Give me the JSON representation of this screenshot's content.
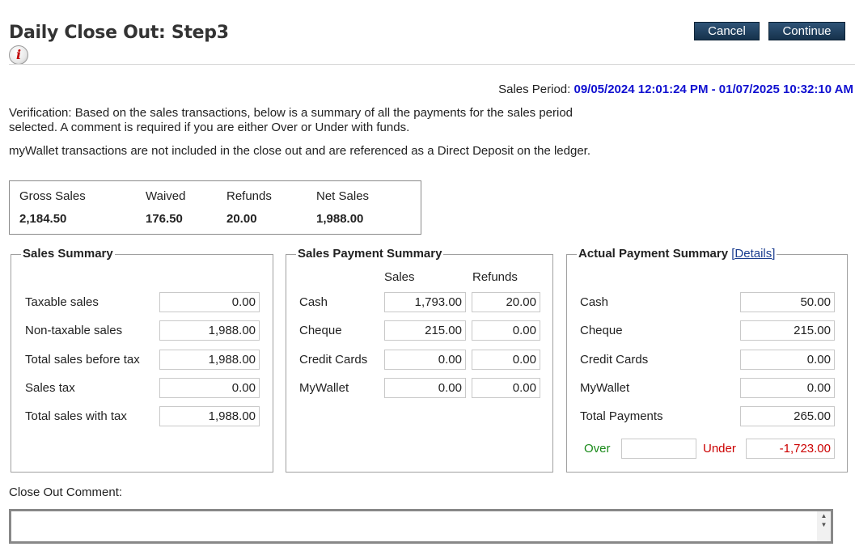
{
  "page": {
    "title": "Daily Close Out: Step3",
    "info_icon_glyph": "i",
    "cancel_label": "Cancel",
    "continue_label": "Continue",
    "sales_period_label": "Sales Period:",
    "sales_period_value": "09/05/2024 12:01:24 PM - 01/07/2025 10:32:10 AM",
    "verification_text": "Verification: Based on the sales transactions, below is a summary of all the payments for the sales period selected. A comment is required if you are either Over or Under with funds.",
    "mywallet_note": "myWallet transactions are not included in the close out and are referenced as a Direct Deposit on the ledger."
  },
  "totals": {
    "gross_label": "Gross Sales",
    "gross_value": "2,184.50",
    "waived_label": "Waived",
    "waived_value": "176.50",
    "refunds_label": "Refunds",
    "refunds_value": "20.00",
    "net_label": "Net Sales",
    "net_value": "1,988.00"
  },
  "sales_summary": {
    "legend": "Sales Summary",
    "rows": [
      {
        "label": "Taxable sales",
        "value": "0.00"
      },
      {
        "label": "Non-taxable sales",
        "value": "1,988.00"
      },
      {
        "label": "Total sales before tax",
        "value": "1,988.00"
      },
      {
        "label": "Sales tax",
        "value": "0.00"
      },
      {
        "label": "Total sales with tax",
        "value": "1,988.00"
      }
    ]
  },
  "payment_summary": {
    "legend": "Sales Payment Summary",
    "col_sales": "Sales",
    "col_refunds": "Refunds",
    "rows": [
      {
        "label": "Cash",
        "sales": "1,793.00",
        "refunds": "20.00"
      },
      {
        "label": "Cheque",
        "sales": "215.00",
        "refunds": "0.00"
      },
      {
        "label": "Credit Cards",
        "sales": "0.00",
        "refunds": "0.00"
      },
      {
        "label": "MyWallet",
        "sales": "0.00",
        "refunds": "0.00"
      }
    ]
  },
  "actual_summary": {
    "legend": "Actual Payment Summary",
    "details_link": "[Details]",
    "rows": [
      {
        "label": "Cash",
        "value": "50.00"
      },
      {
        "label": "Cheque",
        "value": "215.00"
      },
      {
        "label": "Credit Cards",
        "value": "0.00"
      },
      {
        "label": "MyWallet",
        "value": "0.00"
      },
      {
        "label": "Total Payments",
        "value": "265.00"
      }
    ],
    "over_label": "Over",
    "over_value": "",
    "under_label": "Under",
    "under_value": "-1,723.00"
  },
  "comment": {
    "label": "Close Out Comment:",
    "value": ""
  },
  "colors": {
    "period_value": "#1010d0",
    "over": "#1a8a1a",
    "under": "#cc0000",
    "button_bg": "#1f3f5e"
  }
}
